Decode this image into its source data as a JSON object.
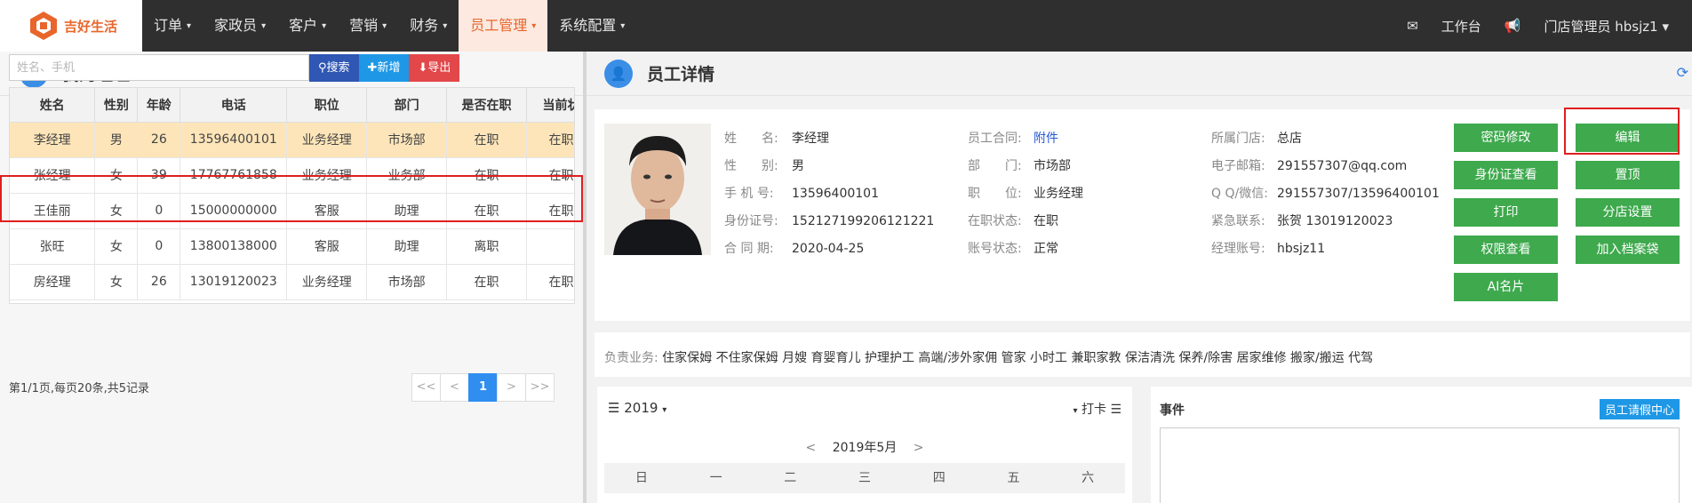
{
  "brand": {
    "name": "吉好生活"
  },
  "nav": {
    "items": [
      {
        "label": "订单",
        "caret": "▾"
      },
      {
        "label": "家政员",
        "caret": "▾"
      },
      {
        "label": "客户",
        "caret": "▾"
      },
      {
        "label": "营销",
        "caret": "▾"
      },
      {
        "label": "财务",
        "caret": "▾"
      },
      {
        "label": "员工管理",
        "caret": "▾",
        "active": true
      },
      {
        "label": "系统配置",
        "caret": "▾"
      }
    ],
    "workbench": "工作台",
    "user": "门店管理员 hbsjz1 ▾"
  },
  "left": {
    "title": "我的经理",
    "search_placeholder": "姓名、手机",
    "btn_search": "搜索",
    "btn_add": "新增",
    "btn_export": "导出",
    "columns": [
      "姓名",
      "性别",
      "年龄",
      "电话",
      "职位",
      "部门",
      "是否在职",
      "当前状"
    ],
    "rows": [
      [
        "李经理",
        "男",
        "26",
        "13596400101",
        "业务经理",
        "市场部",
        "在职",
        "在职"
      ],
      [
        "张经理",
        "女",
        "39",
        "17767761858",
        "业务经理",
        "业务部",
        "在职",
        "在职"
      ],
      [
        "王佳丽",
        "女",
        "0",
        "15000000000",
        "客服",
        "助理",
        "在职",
        "在职"
      ],
      [
        "张旺",
        "女",
        "0",
        "13800138000",
        "客服",
        "助理",
        "离职",
        ""
      ],
      [
        "房经理",
        "女",
        "26",
        "13019120023",
        "业务经理",
        "市场部",
        "在职",
        "在职"
      ]
    ],
    "page_info": "第1/1页,每页20条,共5记录",
    "pager": [
      "<<",
      "<",
      "1",
      ">",
      ">>"
    ]
  },
  "detail": {
    "title": "员工详情",
    "col1": [
      {
        "label": "姓　　名:",
        "value": "李经理"
      },
      {
        "label": "性　　别:",
        "value": "男"
      },
      {
        "label": "手 机 号:",
        "value": "13596400101"
      },
      {
        "label": "身份证号:",
        "value": "152127199206121221"
      },
      {
        "label": "合 同 期:",
        "value": "2020-04-25"
      }
    ],
    "col2": [
      {
        "label": "员工合同:",
        "value": "附件"
      },
      {
        "label": "部　　门:",
        "value": "市场部"
      },
      {
        "label": "职　　位:",
        "value": "业务经理"
      },
      {
        "label": "在职状态:",
        "value": "在职"
      },
      {
        "label": "账号状态:",
        "value": "正常"
      }
    ],
    "col3": [
      {
        "label": "所属门店:",
        "value": "总店"
      },
      {
        "label": "电子邮箱:",
        "value": "291557307@qq.com"
      },
      {
        "label": "Q Q/微信:",
        "value": "291557307/13596400101"
      },
      {
        "label": "紧急联系:",
        "value": "张贺 13019120023"
      },
      {
        "label": "经理账号:",
        "value": "hbsjz11"
      }
    ],
    "buttons_left": [
      "密码修改",
      "身份证查看",
      "打印",
      "权限查看",
      "AI名片"
    ],
    "buttons_right": [
      "编辑",
      "置顶",
      "分店设置",
      "加入档案袋"
    ],
    "duty_label": "负责业务:",
    "duty_value": "住家保姆 不住家保姆 月嫂 育婴育儿 护理护工 高端/涉外家佣 管家 小时工 兼职家教 保洁清洗 保养/除害 居家维修 搬家/搬运 代驾"
  },
  "calendar": {
    "year": "2019",
    "punch": "打卡",
    "month": "2019年5月",
    "weekdays": [
      "日",
      "一",
      "二",
      "三",
      "四",
      "五",
      "六"
    ]
  },
  "events": {
    "title": "事件",
    "leave_btn": "员工请假中心"
  },
  "colors": {
    "accent": "#e8662b",
    "nav_bg": "#2f2f2f",
    "green_btn": "#3ea94d",
    "selected_row": "#fde5b9",
    "highlight": "#e01e1e"
  }
}
